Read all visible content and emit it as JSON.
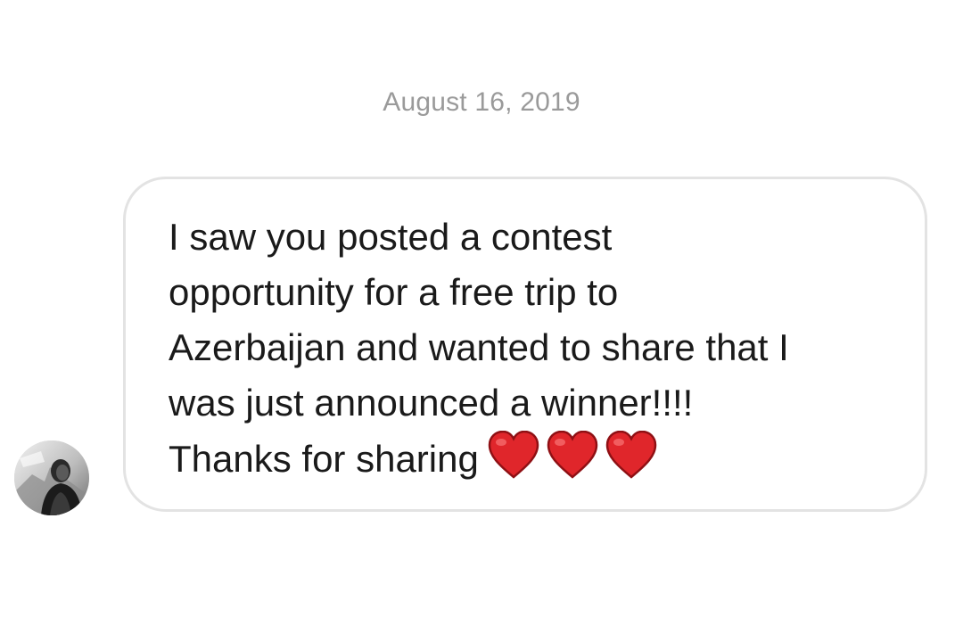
{
  "conversation": {
    "date": "August 16, 2019"
  },
  "message": {
    "lines": [
      "I saw you posted a contest",
      "opportunity for a free trip to",
      "Azerbaijan and wanted to share that I",
      "was just announced a winner!!!!",
      "Thanks for sharing"
    ],
    "emojis": [
      "red-heart-icon",
      "red-heart-icon",
      "red-heart-icon"
    ]
  },
  "colors": {
    "date_text": "#9a9a9a",
    "bubble_border": "#e3e3e3",
    "message_text": "#1a1a1a",
    "heart": "#e0262b"
  }
}
